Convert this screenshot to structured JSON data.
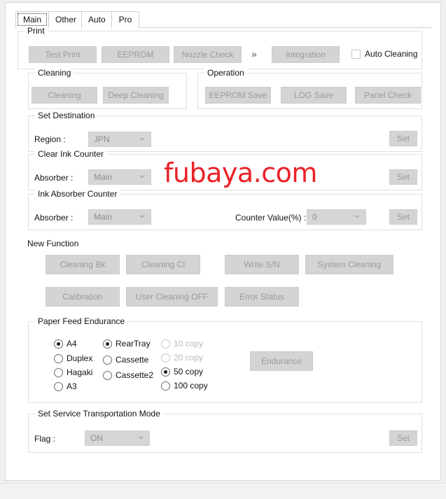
{
  "window": {
    "accent_red": "#ea2127",
    "button_face": "#d4d4d4",
    "disabled_text": "#9a9a9a"
  },
  "watermark": {
    "text": "fubaya.com"
  },
  "tabs": [
    {
      "label": "Main",
      "selected": true
    },
    {
      "label": "Other",
      "selected": false
    },
    {
      "label": "Auto",
      "selected": false
    },
    {
      "label": "Pro",
      "selected": false
    }
  ],
  "print_group": {
    "legend": "Print",
    "buttons": [
      {
        "label": "Test Print"
      },
      {
        "label": "EEPROM"
      },
      {
        "label": "Nozzle Check"
      },
      {
        "label": "Integration"
      }
    ],
    "chevron": "»",
    "checkbox": {
      "label": "Auto Cleaning",
      "checked": false
    }
  },
  "cleaning_group": {
    "legend": "Cleaning",
    "buttons": [
      {
        "label": "Cleaning"
      },
      {
        "label": "Deep Cleaning"
      }
    ]
  },
  "operation_group": {
    "legend": "Operation",
    "buttons": [
      {
        "label": "EEPROM Save"
      },
      {
        "label": "LOG Save"
      },
      {
        "label": "Panel Check"
      }
    ]
  },
  "set_destination": {
    "legend": "Set Destination",
    "region_label": "Region :",
    "region_value": "JPN",
    "set_label": "Set"
  },
  "clear_ink_counter": {
    "legend": "Clear Ink Counter",
    "absorber_label": "Absorber :",
    "absorber_value": "Main",
    "set_label": "Set"
  },
  "ink_absorber_counter": {
    "legend": "Ink Absorber Counter",
    "absorber_label": "Absorber :",
    "absorber_value": "Main",
    "counter_label": "Counter Value(%) :",
    "counter_value": "0",
    "set_label": "Set"
  },
  "new_function": {
    "legend": "New Function",
    "buttons": [
      {
        "label": "Cleaning Bk"
      },
      {
        "label": "Cleaning Cl"
      },
      {
        "label": "Write S/N"
      },
      {
        "label": "System Cleaning"
      },
      {
        "label": "Calibration"
      },
      {
        "label": "User Cleaning OFF"
      },
      {
        "label": "Error Status"
      }
    ]
  },
  "paper_feed_endurance": {
    "legend": "Paper Feed Endurance",
    "paper_size": [
      {
        "label": "A4",
        "checked": true,
        "disabled": false
      },
      {
        "label": "Duplex",
        "checked": false,
        "disabled": false
      },
      {
        "label": "Hagaki",
        "checked": false,
        "disabled": false
      },
      {
        "label": "A3",
        "checked": false,
        "disabled": false
      }
    ],
    "source": [
      {
        "label": "RearTray",
        "checked": true,
        "disabled": false
      },
      {
        "label": "Cassette",
        "checked": false,
        "disabled": false
      },
      {
        "label": "Cassette2",
        "checked": false,
        "disabled": false
      }
    ],
    "copies": [
      {
        "label": "10 copy",
        "checked": false,
        "disabled": true
      },
      {
        "label": "20 copy",
        "checked": false,
        "disabled": true
      },
      {
        "label": "50 copy",
        "checked": true,
        "disabled": false
      },
      {
        "label": "100 copy",
        "checked": false,
        "disabled": false
      }
    ],
    "endurance_button": "Endurance"
  },
  "transportation_mode": {
    "legend": "Set Service Transportation Mode",
    "flag_label": "Flag :",
    "flag_value": "ON",
    "set_label": "Set"
  }
}
